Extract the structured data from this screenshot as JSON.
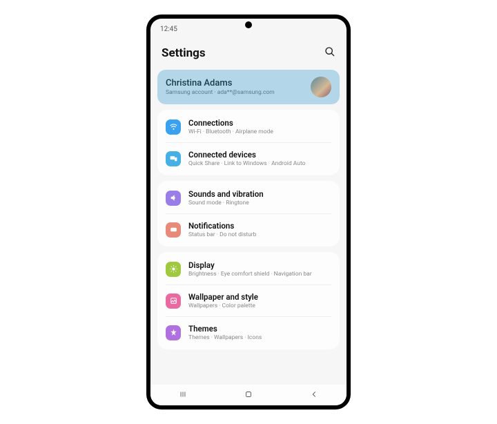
{
  "status": {
    "time": "12:45"
  },
  "header": {
    "title": "Settings"
  },
  "account": {
    "name": "Christina Adams",
    "sub": "Samsung account  ·  ada**@samsung.com"
  },
  "groups": [
    {
      "items": [
        {
          "title": "Connections",
          "sub": "Wi-Fi  ·  Bluetooth  ·  Airplane mode"
        },
        {
          "title": "Connected devices",
          "sub": "Quick Share  ·  Link to Windows  ·  Android Auto"
        }
      ]
    },
    {
      "items": [
        {
          "title": "Sounds and vibration",
          "sub": "Sound mode  ·  Ringtone"
        },
        {
          "title": "Notifications",
          "sub": "Status bar  ·  Do not disturb"
        }
      ]
    },
    {
      "items": [
        {
          "title": "Display",
          "sub": "Brightness  ·  Eye comfort shield  ·  Navigation bar"
        },
        {
          "title": "Wallpaper and style",
          "sub": "Wallpapers  ·  Color palette"
        },
        {
          "title": "Themes",
          "sub": "Themes  ·  Wallpapers  ·  Icons"
        }
      ]
    }
  ]
}
